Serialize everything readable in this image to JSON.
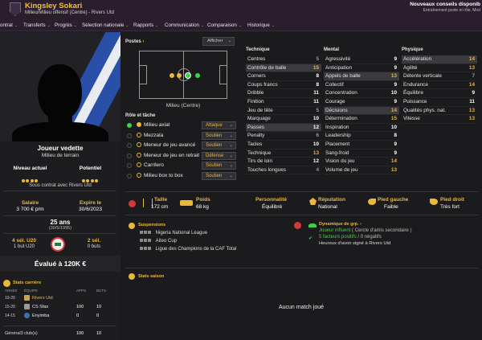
{
  "header": {
    "name": "Kingsley Sokari",
    "subtitle": "Milieu/Milieu offensif (Centre) - Rivers Utd",
    "advice_title": "Nouveaux conseils disponib",
    "advice_sub": "Entraînement poste et rôle. Mod"
  },
  "nav": [
    {
      "label": "ontrat",
      "chev": "⌄"
    },
    {
      "label": "Transferts",
      "chev": "⌄"
    },
    {
      "label": "Progrès",
      "chev": "⌄"
    },
    {
      "label": "Sélection nationale",
      "chev": "⌄"
    },
    {
      "label": "Rapports",
      "chev": "⌄"
    },
    {
      "label": "Communication",
      "chev": "⌄"
    },
    {
      "label": "Comparaison",
      "chev": "⌄"
    },
    {
      "label": "Historique",
      "chev": "⌄"
    }
  ],
  "profile": {
    "status": "Joueur vedette",
    "role": "Milieu de terrain",
    "current_label": "Niveau actuel",
    "potential_label": "Potentiel",
    "contract": "Sous contrat avec Rivers Utd",
    "wage_label": "Salaire",
    "wage": "3 700 € p/m",
    "expires_label": "Expire le",
    "expires": "30/6/2023",
    "age": "25 ans",
    "dob": "(30/5/1995)",
    "u20_caps": "4 sél. U20",
    "u20_goals": "1 but U20",
    "caps": "2 sél.",
    "goals": "0 buts",
    "value": "Évalué à 120K €"
  },
  "career": {
    "title": "Stats carrière",
    "columns": [
      "ANNÉE",
      "ÉQUIPE",
      "APPS",
      "BUTS"
    ],
    "rows": [
      {
        "year": "19-20",
        "team": "Rivers Utd",
        "apps": "",
        "goals": ""
      },
      {
        "year": "15-20",
        "team": "CS Sfax",
        "apps": "100",
        "goals": "10"
      },
      {
        "year": "14-15",
        "team": "Enyimba",
        "apps": "0",
        "goals": "0"
      }
    ],
    "footer": "Général3 club(s)",
    "footer_apps": "100",
    "footer_goals": "10"
  },
  "positions": {
    "title": "Postes",
    "show": "Afficher",
    "caption": "Milieu (Centre)"
  },
  "roles": {
    "title": "Rôle et tâche",
    "items": [
      {
        "name": "Milieu axial",
        "duty": "Attaque",
        "selected": true
      },
      {
        "name": "Mezzala",
        "duty": "Soutien",
        "selected": false
      },
      {
        "name": "Meneur de jeu avancé",
        "duty": "Soutien",
        "selected": false
      },
      {
        "name": "Meneur de jeu en retrait",
        "duty": "Défense",
        "selected": false
      },
      {
        "name": "Carrilero",
        "duty": "Soutien",
        "selected": false
      },
      {
        "name": "Milieu box to box",
        "duty": "Soutien",
        "selected": false
      },
      {
        "name": "Milieu récupérateur",
        "duty": "",
        "selected": false
      }
    ]
  },
  "attributes": {
    "technique": {
      "title": "Technique",
      "rows": [
        {
          "n": "Centres",
          "v": "5"
        },
        {
          "n": "Contrôle de balle",
          "v": "15"
        },
        {
          "n": "Corners",
          "v": "8"
        },
        {
          "n": "Coups francs",
          "v": "8"
        },
        {
          "n": "Dribble",
          "v": "11"
        },
        {
          "n": "Finition",
          "v": "11"
        },
        {
          "n": "Jeu de tête",
          "v": "5"
        },
        {
          "n": "Marquage",
          "v": "10"
        },
        {
          "n": "Passes",
          "v": "12"
        },
        {
          "n": "Penalty",
          "v": "6"
        },
        {
          "n": "Tacles",
          "v": "10"
        },
        {
          "n": "Technique",
          "v": "13"
        },
        {
          "n": "Tirs de loin",
          "v": "12"
        },
        {
          "n": "Touches longues",
          "v": "4"
        }
      ]
    },
    "mental": {
      "title": "Mental",
      "rows": [
        {
          "n": "Agressivité",
          "v": "9"
        },
        {
          "n": "Anticipation",
          "v": "9"
        },
        {
          "n": "Appels de balle",
          "v": "13"
        },
        {
          "n": "Collectif",
          "v": "9"
        },
        {
          "n": "Concentration",
          "v": "10"
        },
        {
          "n": "Courage",
          "v": "9"
        },
        {
          "n": "Décisions",
          "v": "14"
        },
        {
          "n": "Détermination",
          "v": "15"
        },
        {
          "n": "Inspiration",
          "v": "10"
        },
        {
          "n": "Leadership",
          "v": "8"
        },
        {
          "n": "Placement",
          "v": "9"
        },
        {
          "n": "Sang-froid",
          "v": "9"
        },
        {
          "n": "Vision du jeu",
          "v": "14"
        },
        {
          "n": "Volume de jeu",
          "v": "13"
        }
      ]
    },
    "physique": {
      "title": "Physique",
      "rows": [
        {
          "n": "Accélération",
          "v": "14"
        },
        {
          "n": "Agilité",
          "v": "13"
        },
        {
          "n": "Détente verticale",
          "v": "7"
        },
        {
          "n": "Endurance",
          "v": "14"
        },
        {
          "n": "Équilibre",
          "v": "9"
        },
        {
          "n": "Puissance",
          "v": "11"
        },
        {
          "n": "Qualités phys. nat.",
          "v": "13"
        },
        {
          "n": "Vitesse",
          "v": "13"
        }
      ]
    }
  },
  "info": {
    "height_label": "Taille",
    "height": "172 cm",
    "weight_label": "Poids",
    "weight": "68 kg",
    "personality_label": "Personnalité",
    "personality": "Équilibré",
    "reputation_label": "Réputation",
    "reputation": "National",
    "left_foot_label": "Pied gauche",
    "left_foot": "Faible",
    "right_foot_label": "Pied droit",
    "right_foot": "Très fort"
  },
  "suspensions": {
    "title": "Suspensions",
    "items": [
      "Nigeria National League",
      "Aiteo Cup",
      "Ligue des Champions de la CAF Total"
    ]
  },
  "dynamics": {
    "title": "Dynamique de grp.",
    "line1": "Joueur influent",
    "line1b": "( Cercle d'amis secondaire )",
    "line2a": "5 facteurs positifs",
    "line2b": "/ 0 négatifs",
    "line3": "Heureux d'avoir signé à Rivers Utd"
  },
  "season": {
    "title": "Stats saison",
    "empty": "Aucun match joué"
  },
  "colors": {
    "accent": "#e9b83c",
    "header": "#2a1d2c",
    "green": "#3fd14a",
    "red": "#d23a3a"
  }
}
